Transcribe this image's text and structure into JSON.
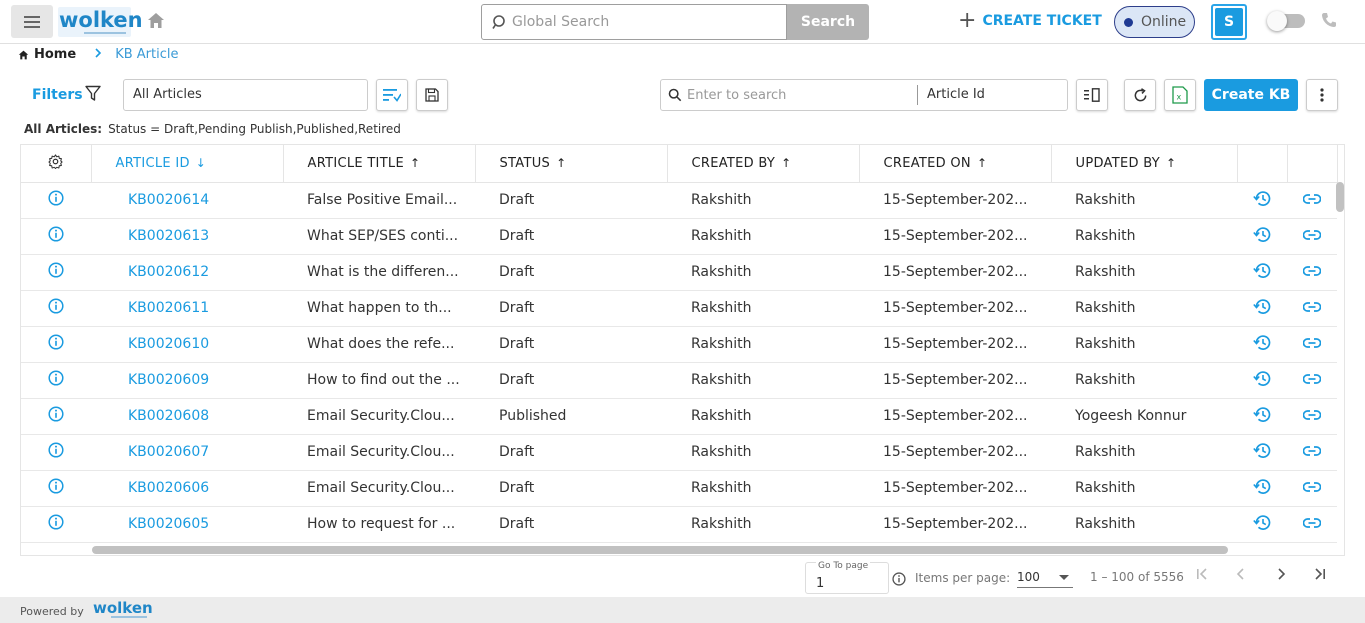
{
  "header": {
    "logo_text": "wolken",
    "search": {
      "placeholder": "Global Search",
      "value": "",
      "button_label": "Search"
    },
    "create_ticket_label": "CREATE TICKET",
    "status_label": "Online",
    "avatar_initial": "S",
    "icons": [
      "menu-icon",
      "home-icon",
      "search-icon",
      "plus-icon",
      "toggle-switch",
      "phone-icon"
    ]
  },
  "breadcrumb": {
    "home": "Home",
    "separator": ">",
    "current": "KB Article"
  },
  "filterbar": {
    "filters_label": "Filters",
    "view_value": "All Articles",
    "kb_search": {
      "placeholder": "Enter to search",
      "field_value": "Article Id"
    },
    "create_kb_label": "Create KB"
  },
  "summary": {
    "label": "All Articles:",
    "text": "Status = Draft,Pending Publish,Published,Retired"
  },
  "table": {
    "columns": [
      "ARTICLE ID",
      "ARTICLE TITLE",
      "STATUS",
      "CREATED BY",
      "CREATED ON",
      "UPDATED BY"
    ],
    "sort_arrows": [
      "↓",
      "↑",
      "↑",
      "↑",
      "↑",
      "↑"
    ],
    "rows": [
      {
        "id": "KB0020614",
        "title": "False Positive Email...",
        "status": "Draft",
        "created_by": "Rakshith",
        "created_on": "15-September-202...",
        "updated_by": "Rakshith"
      },
      {
        "id": "KB0020613",
        "title": "What SEP/SES conti...",
        "status": "Draft",
        "created_by": "Rakshith",
        "created_on": "15-September-202...",
        "updated_by": "Rakshith"
      },
      {
        "id": "KB0020612",
        "title": "What is the differen...",
        "status": "Draft",
        "created_by": "Rakshith",
        "created_on": "15-September-202...",
        "updated_by": "Rakshith"
      },
      {
        "id": "KB0020611",
        "title": "What happen to th...",
        "status": "Draft",
        "created_by": "Rakshith",
        "created_on": "15-September-202...",
        "updated_by": "Rakshith"
      },
      {
        "id": "KB0020610",
        "title": "What does the refe...",
        "status": "Draft",
        "created_by": "Rakshith",
        "created_on": "15-September-202...",
        "updated_by": "Rakshith"
      },
      {
        "id": "KB0020609",
        "title": "How to find out the ...",
        "status": "Draft",
        "created_by": "Rakshith",
        "created_on": "15-September-202...",
        "updated_by": "Rakshith"
      },
      {
        "id": "KB0020608",
        "title": "Email Security.Clou...",
        "status": "Published",
        "created_by": "Rakshith",
        "created_on": "15-September-202...",
        "updated_by": "Yogeesh Konnur"
      },
      {
        "id": "KB0020607",
        "title": "Email Security.Clou...",
        "status": "Draft",
        "created_by": "Rakshith",
        "created_on": "15-September-202...",
        "updated_by": "Rakshith"
      },
      {
        "id": "KB0020606",
        "title": "Email Security.Clou...",
        "status": "Draft",
        "created_by": "Rakshith",
        "created_on": "15-September-202...",
        "updated_by": "Rakshith"
      },
      {
        "id": "KB0020605",
        "title": "How to request for ...",
        "status": "Draft",
        "created_by": "Rakshith",
        "created_on": "15-September-202...",
        "updated_by": "Rakshith"
      }
    ]
  },
  "pagination": {
    "goto_label": "Go To page",
    "goto_value": "1",
    "items_per_page_label": "Items per page:",
    "items_per_page_value": "100",
    "range_text": "1 – 100 of 5556"
  },
  "footer": {
    "powered_by": "Powered by",
    "logo_text": "wolken"
  },
  "colors": {
    "accent": "#1a9be0",
    "online_bg": "#dbe6f6",
    "online_dot": "#1f3a93",
    "search_button": "#b3b3b3"
  }
}
